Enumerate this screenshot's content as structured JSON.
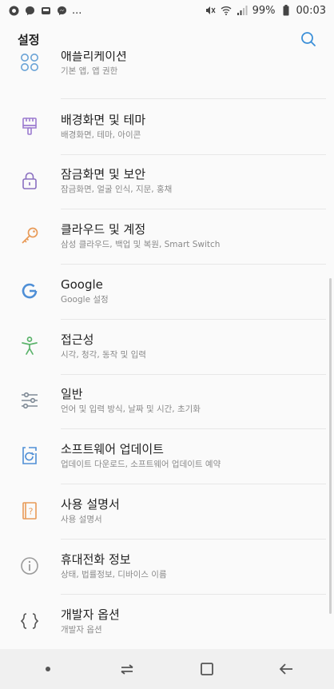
{
  "status_bar": {
    "left_icons": [
      "app-icon",
      "messenger-icon",
      "shuttle-icon",
      "messenger-icon",
      "more-dots"
    ],
    "more_text": "...",
    "battery": "99%",
    "time": "00:03"
  },
  "header": {
    "title": "설정"
  },
  "items": [
    {
      "label": "애플리케이션",
      "sub": "기본 앱, 앱 권한",
      "icon": "apps-icon",
      "color": "#6aa3d6"
    },
    {
      "label": "배경화면 및 테마",
      "sub": "배경화면, 테마, 아이콘",
      "icon": "brush-icon",
      "color": "#9b7bd0"
    },
    {
      "label": "잠금화면 및 보안",
      "sub": "잠금화면, 얼굴 인식, 지문, 홍채",
      "icon": "lock-icon",
      "color": "#8a6fc0"
    },
    {
      "label": "클라우드 및 계정",
      "sub": "삼성 클라우드, 백업 및 복원, Smart Switch",
      "icon": "key-icon",
      "color": "#e89a57"
    },
    {
      "label": "Google",
      "sub": "Google 설정",
      "icon": "google-icon",
      "color": "#4f8fd6"
    },
    {
      "label": "접근성",
      "sub": "시각, 청각, 동작 및 입력",
      "icon": "accessibility-icon",
      "color": "#5bb36b"
    },
    {
      "label": "일반",
      "sub": "언어 및 입력 방식, 날짜 및 시간, 초기화",
      "icon": "sliders-icon",
      "color": "#7f8a96"
    },
    {
      "label": "소프트웨어 업데이트",
      "sub": "업데이트 다운로드, 소프트웨어 업데이트 예약",
      "icon": "update-icon",
      "color": "#4f8fd6"
    },
    {
      "label": "사용 설명서",
      "sub": "사용 설명서",
      "icon": "manual-icon",
      "color": "#e89a57"
    },
    {
      "label": "휴대전화 정보",
      "sub": "상태, 법률정보, 디바이스 이름",
      "icon": "info-icon",
      "color": "#9a9a9a"
    },
    {
      "label": "개발자 옵션",
      "sub": "개발자 옵션",
      "icon": "developer-icon",
      "color": "#555555"
    }
  ]
}
